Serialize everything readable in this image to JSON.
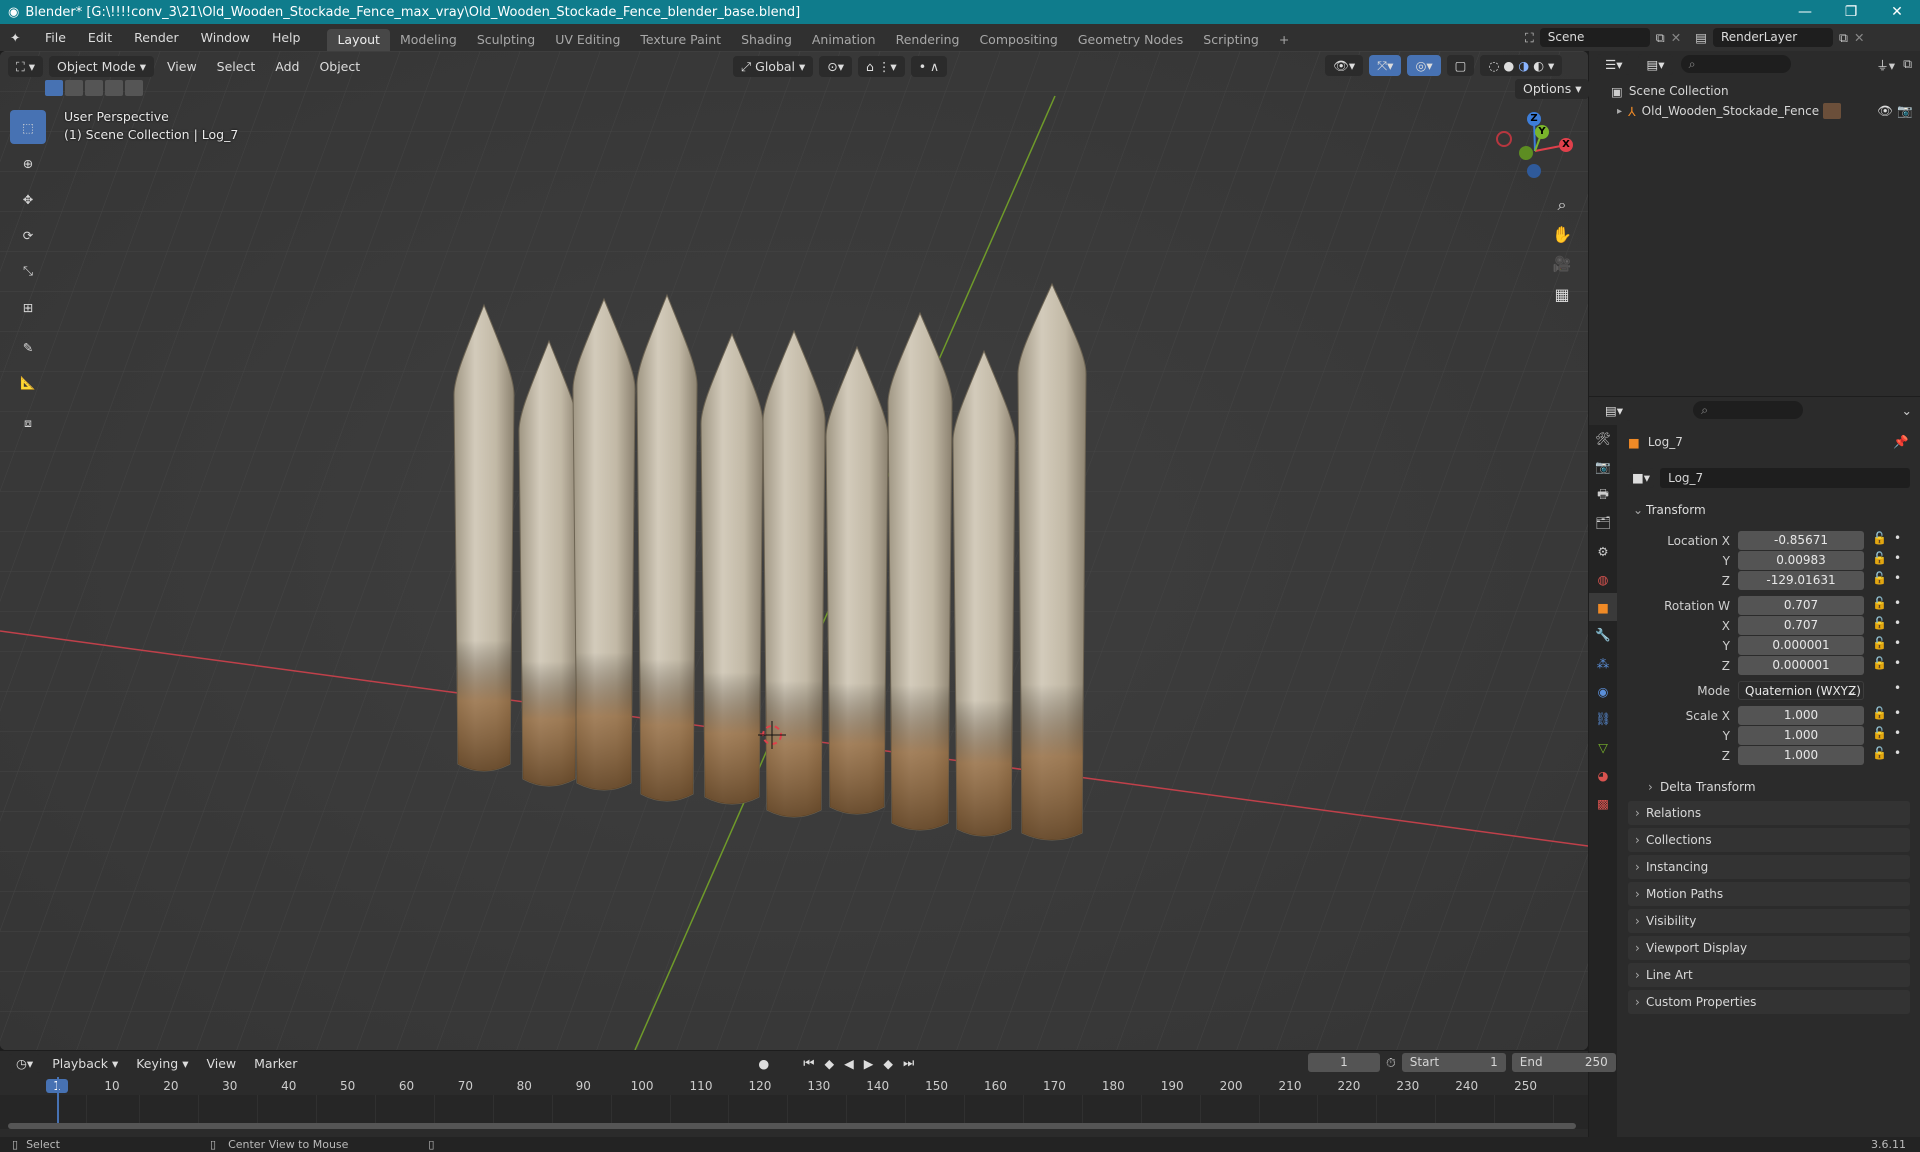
{
  "window": {
    "title": "Blender* [G:\\!!!!conv_3\\21\\Old_Wooden_Stockade_Fence_max_vray\\Old_Wooden_Stockade_Fence_blender_base.blend]",
    "minimize": "—",
    "maximize": "❐",
    "close": "✕"
  },
  "menus": [
    "File",
    "Edit",
    "Render",
    "Window",
    "Help"
  ],
  "workspaces": [
    "Layout",
    "Modeling",
    "Sculpting",
    "UV Editing",
    "Texture Paint",
    "Shading",
    "Animation",
    "Rendering",
    "Compositing",
    "Geometry Nodes",
    "Scripting",
    "+"
  ],
  "scene_name": "Scene",
  "render_layer": "RenderLayer",
  "viewport": {
    "mode": "Object Mode",
    "menus": [
      "View",
      "Select",
      "Add",
      "Object"
    ],
    "orientation": "Global",
    "options_label": "Options",
    "perspective": "User Perspective",
    "collection_info": "(1) Scene Collection | Log_7",
    "gizmo": {
      "x": "X",
      "y": "Y",
      "z": "Z"
    }
  },
  "outliner": {
    "root": "Scene Collection",
    "items": [
      {
        "name": "Old_Wooden_Stockade_Fence"
      }
    ]
  },
  "properties": {
    "object_name": "Log_7",
    "data_name": "Log_7",
    "transform_label": "Transform",
    "location": {
      "label": "Location X",
      "x": "-0.85671",
      "y": "0.00983",
      "z": "-129.01631"
    },
    "rotation": {
      "label": "Rotation W",
      "w": "0.707",
      "x": "0.707",
      "y": "0.000001",
      "z": "0.000001"
    },
    "mode": {
      "label": "Mode",
      "value": "Quaternion (WXYZ)"
    },
    "scale": {
      "label": "Scale X",
      "x": "1.000",
      "y": "1.000",
      "z": "1.000"
    },
    "axis_labels": {
      "x": "X",
      "y": "Y",
      "z": "Z"
    },
    "delta_transform": "Delta Transform",
    "panels": [
      "Relations",
      "Collections",
      "Instancing",
      "Motion Paths",
      "Visibility",
      "Viewport Display",
      "Line Art",
      "Custom Properties"
    ]
  },
  "timeline": {
    "menus": [
      "Playback",
      "Keying",
      "View",
      "Marker"
    ],
    "current_frame": "1",
    "start_label": "Start",
    "start": "1",
    "end_label": "End",
    "end": "250",
    "ticks": [
      "1",
      "10",
      "20",
      "30",
      "40",
      "50",
      "60",
      "70",
      "80",
      "90",
      "100",
      "110",
      "120",
      "130",
      "140",
      "150",
      "160",
      "170",
      "180",
      "190",
      "200",
      "210",
      "220",
      "230",
      "240",
      "250"
    ]
  },
  "status": {
    "select": "Select",
    "center_view": "Center View to Mouse",
    "version": "3.6.11"
  },
  "colors": {
    "accent": "#4772b3",
    "titlebar": "#0f7c8c",
    "x_axis": "#e0404b",
    "y_axis": "#7ab52b",
    "z_axis": "#3d7dd8",
    "object_orange": "#f08a26"
  }
}
